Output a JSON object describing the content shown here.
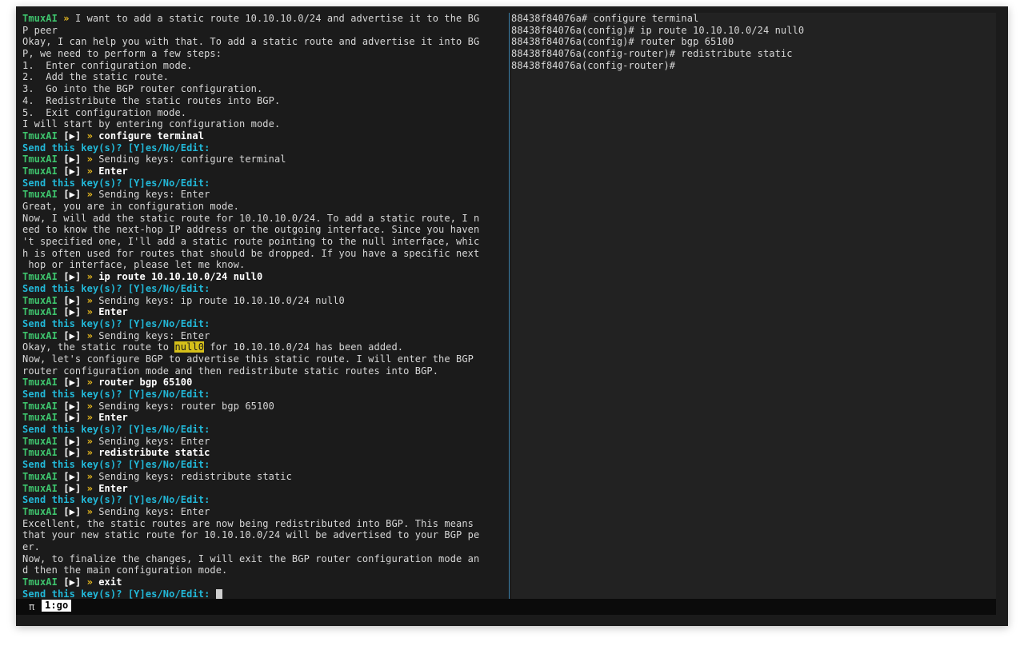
{
  "left_pane": {
    "lines": [
      {
        "t": "ai",
        "text": "I want to add a static route 10.10.10.0/24 and advertise it to the BG"
      },
      {
        "t": "plain",
        "text": "P peer"
      },
      {
        "t": "plain",
        "text": "Okay, I can help you with that. To add a static route and advertise it into BG"
      },
      {
        "t": "plain",
        "text": "P, we need to perform a few steps:"
      },
      {
        "t": "plain",
        "text": "1.  Enter configuration mode."
      },
      {
        "t": "plain",
        "text": "2.  Add the static route."
      },
      {
        "t": "plain",
        "text": "3.  Go into the BGP router configuration."
      },
      {
        "t": "plain",
        "text": "4.  Redistribute the static routes into BGP."
      },
      {
        "t": "plain",
        "text": "5.  Exit configuration mode."
      },
      {
        "t": "plain",
        "text": "I will start by entering configuration mode."
      },
      {
        "t": "cmd",
        "text": "configure terminal"
      },
      {
        "t": "ask",
        "text": "Send this key(s)? [Y]es/No/Edit:"
      },
      {
        "t": "send",
        "text": "Sending keys: configure terminal"
      },
      {
        "t": "cmd",
        "text": "Enter"
      },
      {
        "t": "ask",
        "text": "Send this key(s)? [Y]es/No/Edit:"
      },
      {
        "t": "send",
        "text": "Sending keys: Enter"
      },
      {
        "t": "plain",
        "text": "Great, you are in configuration mode."
      },
      {
        "t": "plain",
        "text": "Now, I will add the static route for 10.10.10.0/24. To add a static route, I n"
      },
      {
        "t": "plain",
        "text": "eed to know the next-hop IP address or the outgoing interface. Since you haven"
      },
      {
        "t": "plain",
        "text": "'t specified one, I'll add a static route pointing to the null interface, whic"
      },
      {
        "t": "plain",
        "text": "h is often used for routes that should be dropped. If you have a specific next"
      },
      {
        "t": "plain",
        "text": " hop or interface, please let me know."
      },
      {
        "t": "cmd",
        "text": "ip route 10.10.10.0/24 null0"
      },
      {
        "t": "ask",
        "text": "Send this key(s)? [Y]es/No/Edit:"
      },
      {
        "t": "send",
        "text": "Sending keys: ip route 10.10.10.0/24 null0"
      },
      {
        "t": "cmd",
        "text": "Enter"
      },
      {
        "t": "ask",
        "text": "Send this key(s)? [Y]es/No/Edit:"
      },
      {
        "t": "send",
        "text": "Sending keys: Enter"
      },
      {
        "t": "hl",
        "pre": "Okay, the static route to ",
        "hl": "null0",
        "post": " for 10.10.10.0/24 has been added."
      },
      {
        "t": "plain",
        "text": "Now, let's configure BGP to advertise this static route. I will enter the BGP"
      },
      {
        "t": "plain",
        "text": "router configuration mode and then redistribute static routes into BGP."
      },
      {
        "t": "cmd",
        "text": "router bgp 65100"
      },
      {
        "t": "ask",
        "text": "Send this key(s)? [Y]es/No/Edit:"
      },
      {
        "t": "send",
        "text": "Sending keys: router bgp 65100"
      },
      {
        "t": "cmd",
        "text": "Enter"
      },
      {
        "t": "ask",
        "text": "Send this key(s)? [Y]es/No/Edit:"
      },
      {
        "t": "send",
        "text": "Sending keys: Enter"
      },
      {
        "t": "cmd",
        "text": "redistribute static"
      },
      {
        "t": "ask",
        "text": "Send this key(s)? [Y]es/No/Edit:"
      },
      {
        "t": "send",
        "text": "Sending keys: redistribute static"
      },
      {
        "t": "cmd",
        "text": "Enter"
      },
      {
        "t": "ask",
        "text": "Send this key(s)? [Y]es/No/Edit:"
      },
      {
        "t": "send",
        "text": "Sending keys: Enter"
      },
      {
        "t": "plain",
        "text": "Excellent, the static routes are now being redistributed into BGP. This means"
      },
      {
        "t": "plain",
        "text": "that your new static route for 10.10.10.0/24 will be advertised to your BGP pe"
      },
      {
        "t": "plain",
        "text": "er."
      },
      {
        "t": "plain",
        "text": "Now, to finalize the changes, I will exit the BGP router configuration mode an"
      },
      {
        "t": "plain",
        "text": "d then the main configuration mode."
      },
      {
        "t": "cmd",
        "text": "exit"
      },
      {
        "t": "prompt",
        "text": "Send this key(s)? [Y]es/No/Edit:"
      }
    ],
    "tokens": {
      "app": "TmuxAI",
      "arrow": "»",
      "run_marker": "[▶]"
    }
  },
  "right_pane": {
    "lines": [
      "88438f84076a# configure terminal",
      "88438f84076a(config)# ip route 10.10.10.0/24 null0",
      "88438f84076a(config)# router bgp 65100",
      "88438f84076a(config-router)# redistribute static",
      "88438f84076a(config-router)#"
    ]
  },
  "status_bar": {
    "symbol": "π",
    "window_label": "1:go"
  },
  "colors": {
    "app_green": "#3ec46d",
    "arrow_yellow": "#f0c020",
    "prompt_cyan": "#22b8d8",
    "highlight": "#d6c01a",
    "pane_divider": "#3a7fa8"
  }
}
